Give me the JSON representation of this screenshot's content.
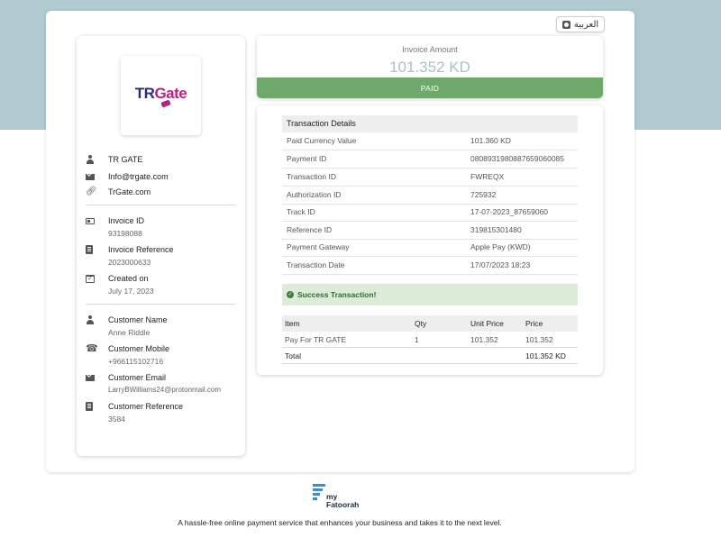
{
  "language_button": "العربية",
  "merchant": {
    "logo": {
      "part1": "TR",
      "part2": "Gate"
    },
    "name": "TR GATE",
    "email": "Info@trgate.com",
    "website": "TrGate.com"
  },
  "invoice": {
    "id_label": "Invoice ID",
    "id_value": "93198088",
    "reference_label": "Invoice Reference",
    "reference_value": "2023000633",
    "created_label": "Created on",
    "created_value": "July 17, 2023"
  },
  "customer": {
    "name_label": "Customer Name",
    "name_value": "Anne Riddle",
    "mobile_label": "Customer Mobile",
    "mobile_value": "+966115102716",
    "email_label": "Customer Email",
    "email_value": "LarryBWilliams24@protonmail.com",
    "reference_label": "Customer Reference",
    "reference_value": "3584"
  },
  "amount": {
    "label": "Invoice Amount",
    "value": "101.352 KD",
    "status": "PAID"
  },
  "transaction": {
    "title": "Transaction Details",
    "rows": [
      {
        "key": "Paid Currency Value",
        "value": "101.360 KD"
      },
      {
        "key": "Payment ID",
        "value": "0808931980887659060085"
      },
      {
        "key": "Transaction ID",
        "value": "FWREQX"
      },
      {
        "key": "Authorization ID",
        "value": "725932"
      },
      {
        "key": "Track ID",
        "value": "17-07-2023_87659060"
      },
      {
        "key": "Reference ID",
        "value": "319815301480"
      },
      {
        "key": "Payment Gateway",
        "value": "Apple Pay (KWD)"
      },
      {
        "key": "Transaction Date",
        "value": "17/07/2023 18:23"
      }
    ],
    "success_message": "Success Transaction!"
  },
  "items": {
    "headers": {
      "item": "Item",
      "qty": "Qty",
      "unit_price": "Unit Price",
      "price": "Price"
    },
    "rows": [
      {
        "item": "Pay For TR GATE",
        "qty": "1",
        "unit_price": "101.352",
        "price": "101.352"
      }
    ],
    "total_label": "Total",
    "total_value": "101.352 KD"
  },
  "footer": {
    "brand_line1": "my",
    "brand_line2": "Fatoorah",
    "tagline": "A hassle-free online payment service that enhances your business and takes it to the next level."
  },
  "colors": {
    "header_band": "#b0cbd0",
    "paid_bar": "#6ea86a",
    "success_bg": "#dcecd8",
    "amount_text": "#a8c2c6"
  }
}
